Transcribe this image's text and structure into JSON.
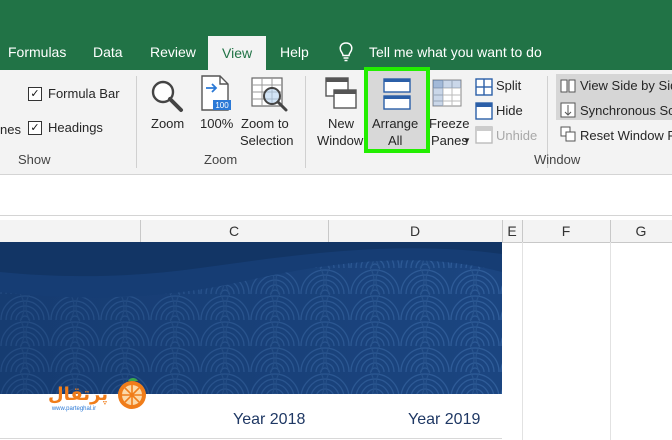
{
  "tabs": {
    "formulas": "Formulas",
    "data": "Data",
    "review": "Review",
    "view": "View",
    "help": "Help",
    "tell_me": "Tell me what you want to do"
  },
  "show_group": {
    "partial_left": "nes",
    "formula_bar": "Formula Bar",
    "headings": "Headings",
    "label": "Show",
    "formula_bar_checked": true,
    "headings_checked": true
  },
  "zoom_group": {
    "zoom": "Zoom",
    "hundred": "100%",
    "hundred_icon_text": "100",
    "zoom_to_selection_1": "Zoom to",
    "zoom_to_selection_2": "Selection",
    "label": "Zoom"
  },
  "window_group": {
    "new_window_1": "New",
    "new_window_2": "Window",
    "arrange_all_1": "Arrange",
    "arrange_all_2": "All",
    "freeze_panes_1": "Freeze",
    "freeze_panes_2": "Panes",
    "split": "Split",
    "hide": "Hide",
    "unhide": "Unhide",
    "view_side_by_side": "View Side by Sid",
    "synchronous_scrolling": "Synchronous Sc",
    "reset_window_position": "Reset Window P",
    "label": "Window"
  },
  "columns": [
    "C",
    "D",
    "E",
    "F",
    "G"
  ],
  "cells": {
    "year_2018": "Year 2018",
    "year_2019": "Year 2019"
  },
  "watermark": {
    "site": "www.parteghal.ir",
    "name": "پرتقال"
  },
  "colors": {
    "excel_green": "#217346",
    "ribbon_bg": "#f3f3f3",
    "highlight_green": "#22ee00",
    "banner_blue": "#1e4a86",
    "orange": "#f07d1a"
  }
}
